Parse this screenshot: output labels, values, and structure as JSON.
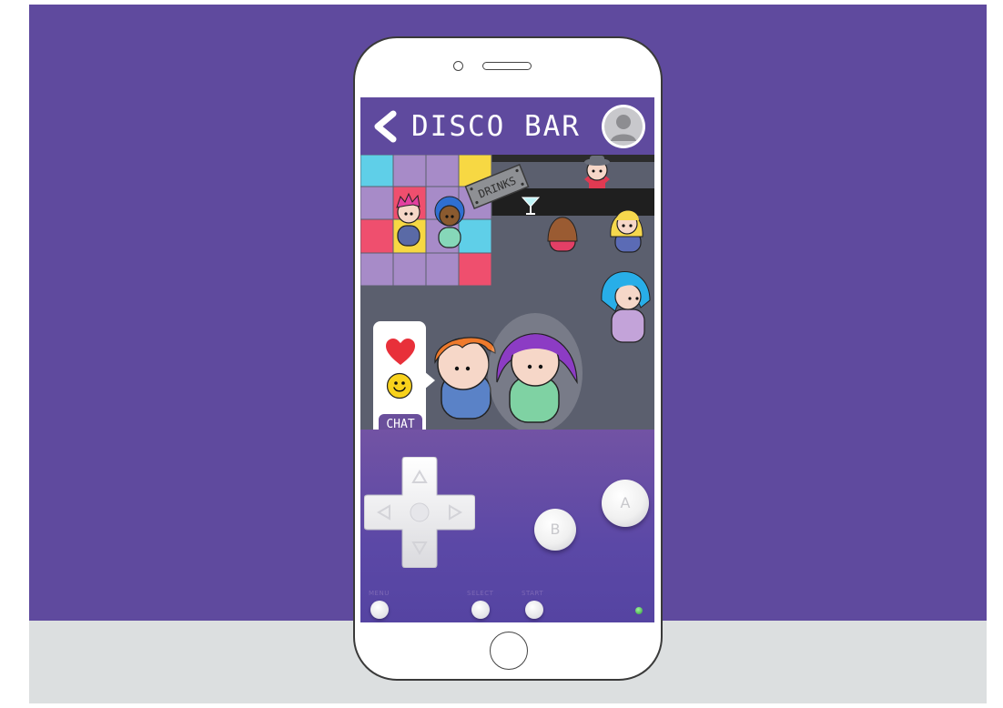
{
  "app": {
    "title": "DISCO BAR"
  },
  "scene": {
    "bar_sign": "DRINKS"
  },
  "emote_panel": {
    "chat_label": "CHAT",
    "items": [
      "heart-icon",
      "smiley-icon",
      "chat-button"
    ]
  },
  "controls": {
    "button_a": "A",
    "button_b": "B",
    "menu_label": "MENU",
    "select_label": "SELECT",
    "start_label": "START"
  },
  "colors": {
    "background": "#5f4a9e",
    "floor": "#5b5f6e",
    "bar_counter": "#222222",
    "tile_cyan": "#5fcfe8",
    "tile_lavender": "#a78bc8",
    "tile_yellow": "#f7d843",
    "tile_pink": "#ef4f6e",
    "heart": "#e8303a",
    "smiley": "#f8d21c",
    "led": "#3dbb45"
  }
}
